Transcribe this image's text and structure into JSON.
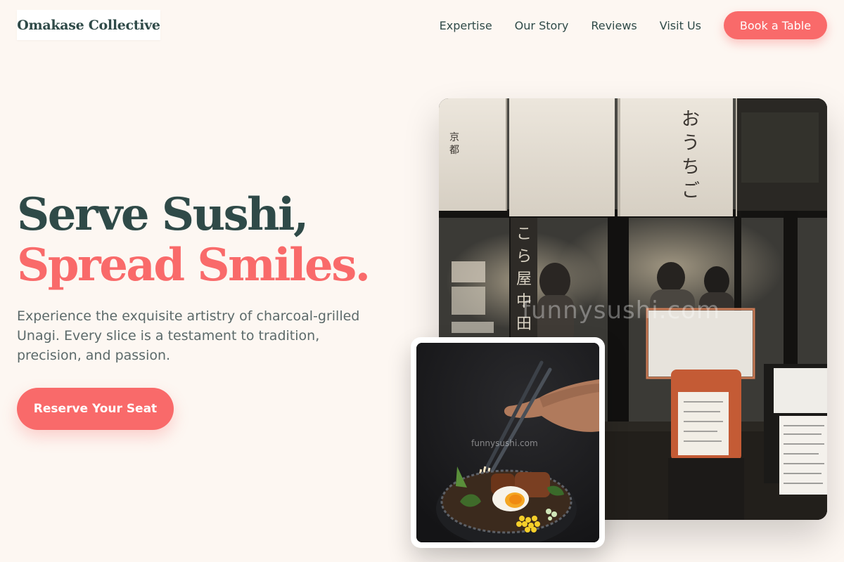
{
  "brand": {
    "name": "Omakase Collective"
  },
  "nav": {
    "links": [
      "Expertise",
      "Our Story",
      "Reviews",
      "Visit Us"
    ],
    "cta_label": "Book a Table"
  },
  "hero": {
    "line1": "Serve Sushi,",
    "line2": "Spread Smiles.",
    "description": "Experience the exquisite artistry of charcoal-grilled Unagi. Every slice is a testament to tradition, precision, and passion.",
    "cta_label": "Reserve Your Seat"
  },
  "images": {
    "storefront_watermark": "funnysushi.com",
    "bowl_watermark": "funnysushi.com"
  },
  "colors": {
    "background": "#fdf7f2",
    "primary_dark": "#2f4a48",
    "accent": "#f96a6a",
    "body_text": "#5c6a6a"
  }
}
